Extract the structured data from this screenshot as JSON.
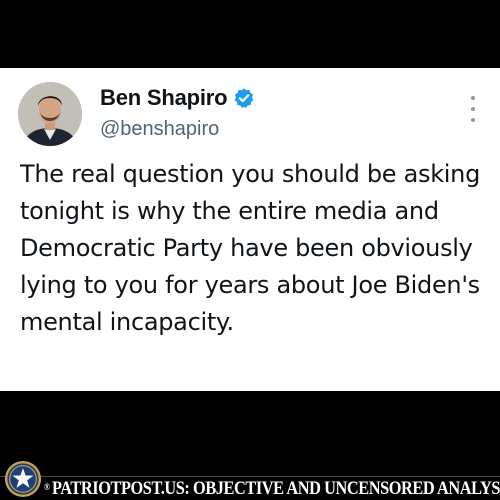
{
  "tweet": {
    "author": {
      "display_name": "Ben Shapiro",
      "handle": "@benshapiro",
      "verified": true,
      "verified_color": "#1d9bf0"
    },
    "text": "The real question you should be asking tonight is why the entire media and Democratic Party have been obviously lying to you for years about Joe Biden's mental incapacity."
  },
  "footer": {
    "registered_mark": "®",
    "tagline": "PATRIOTPOST.US: OBJECTIVE AND UNCENSORED ANALYSIS",
    "logo_icon": "star-seal-icon"
  },
  "colors": {
    "background": "#000000",
    "card": "#ffffff",
    "text_primary": "#0f1419",
    "text_secondary": "#536471",
    "seal_blue": "#1f3f7a",
    "seal_gold": "#c9a24a"
  }
}
